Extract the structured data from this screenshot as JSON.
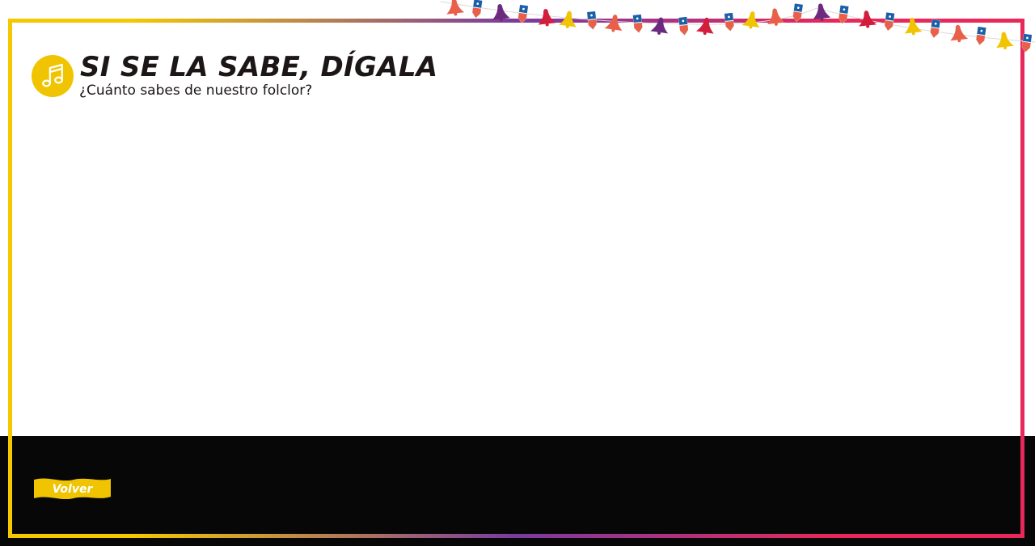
{
  "header": {
    "title": "SI SE LA SABE, DÍGALA",
    "subtitle": "¿Cuánto sabes de nuestro folclor?",
    "icon": "music-note-icon"
  },
  "footer": {
    "back_label": "Volver"
  },
  "colors": {
    "frame_gradient": [
      "#f5c800",
      "#7a3aa0",
      "#e8285a"
    ],
    "accent_yellow": "#f0c400",
    "bottom_bar": "#070707",
    "text": "#1c1616"
  },
  "decoration": {
    "bunting_shapes": [
      "bell",
      "flag",
      "bell",
      "flag",
      "bell",
      "bell",
      "flag",
      "bell",
      "flag",
      "bell",
      "flag",
      "bell",
      "flag",
      "bell",
      "bell",
      "flag",
      "bell",
      "flag",
      "bell",
      "flag",
      "bell",
      "flag",
      "bell",
      "flag",
      "bell",
      "flag"
    ],
    "bunting_colors": [
      "#e8604a",
      "#1a5fa8",
      "#6b2a7e",
      "#1a5fa8",
      "#d21e3c",
      "#f0c400",
      "#1a5fa8",
      "#e8604a",
      "#1a5fa8",
      "#6b2a7e",
      "#1a5fa8",
      "#d21e3c",
      "#1a5fa8",
      "#f0c400",
      "#e8604a",
      "#1a5fa8",
      "#6b2a7e",
      "#1a5fa8",
      "#d21e3c",
      "#1a5fa8",
      "#f0c400",
      "#1a5fa8",
      "#e8604a",
      "#1a5fa8",
      "#f0c400",
      "#1a5fa8"
    ]
  }
}
